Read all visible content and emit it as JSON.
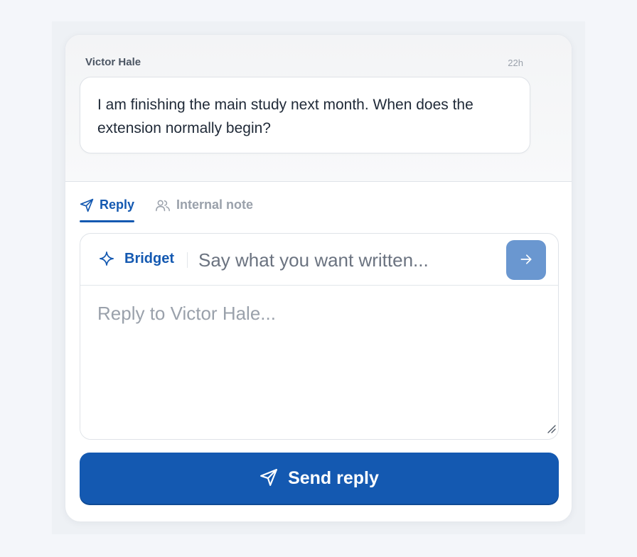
{
  "message": {
    "author": "Victor Hale",
    "time": "22h",
    "text": "I am finishing the main study next month. When does the extension normally begin?"
  },
  "tabs": [
    {
      "label": "Reply",
      "icon": "paper-plane-icon",
      "active": true
    },
    {
      "label": "Internal note",
      "icon": "users-icon",
      "active": false
    }
  ],
  "assistant": {
    "name": "Bridget",
    "icon": "sparkle-icon",
    "placeholder": "Say what you want written...",
    "send_icon": "arrow-right-icon"
  },
  "composer": {
    "placeholder": "Reply to Victor Hale...",
    "value": ""
  },
  "send_button": {
    "label": "Send reply",
    "icon": "paper-plane-icon"
  },
  "colors": {
    "accent": "#1459b1",
    "assist_send": "#6a97d0",
    "muted": "#9aa1ab"
  }
}
